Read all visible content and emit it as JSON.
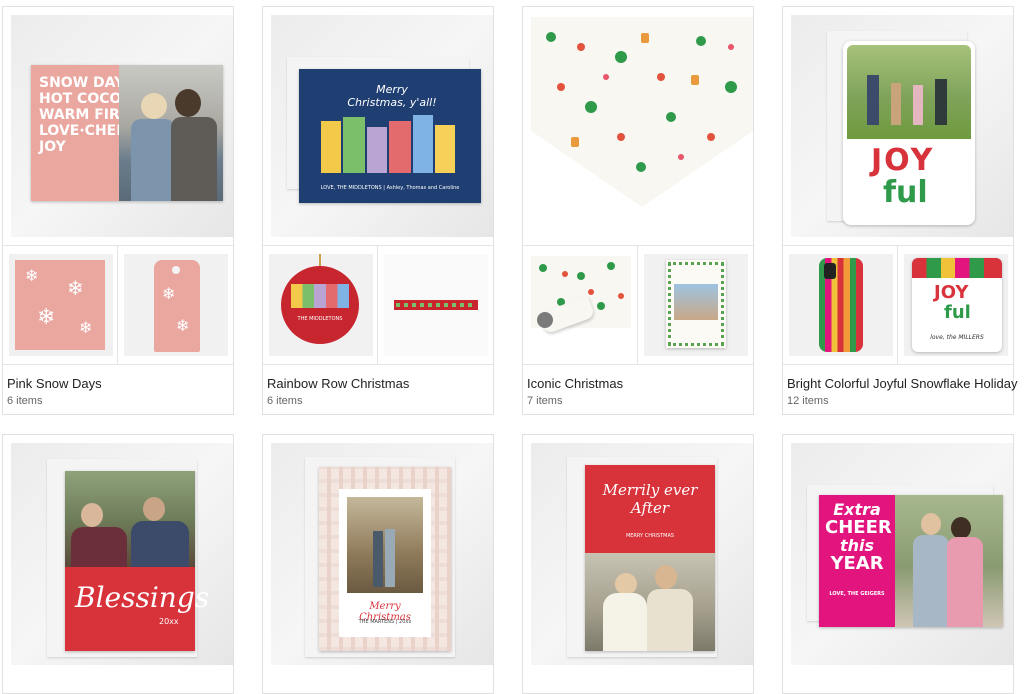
{
  "collections": [
    {
      "title": "Pink Snow Days",
      "count": "6 items",
      "card_lines": [
        "SNOW DAYS",
        "HOT COCOA",
        "WARM FIRES",
        "LOVE·CHEER",
        "JOY"
      ]
    },
    {
      "title": "Rainbow Row Christmas",
      "count": "6 items",
      "card_text": "Merry Christmas, y'all!",
      "footer": "LOVE, THE MIDDLETONS | Ashley, Thomas and Caroline",
      "ornament_text": "THE MIDDLETONS"
    },
    {
      "title": "Iconic Christmas",
      "count": "7 items"
    },
    {
      "title": "Bright Colorful Joyful Snowflake Holiday",
      "count": "12 items",
      "card_words": [
        "JOY",
        "ful"
      ],
      "signature": "love, the MILLERS"
    },
    {
      "title": "",
      "count": "",
      "card_text": "Blessings",
      "year": "20xx"
    },
    {
      "title": "",
      "count": "",
      "card_text": "Merry Christmas",
      "sub": "THE MARTENS | 20xx"
    },
    {
      "title": "",
      "count": "",
      "card_text": "Merrily ever After",
      "sub": "MERRY CHRISTMAS"
    },
    {
      "title": "",
      "count": "",
      "card_lines": [
        "Extra",
        "CHEER",
        "this",
        "YEAR"
      ],
      "sub": "LOVE, THE GEIGERS"
    }
  ],
  "colors": {
    "pink": "#e9a7a0",
    "navy": "#1f3f72",
    "red": "#d8323b",
    "magenta": "#e2157e",
    "green": "#2e9a4a"
  }
}
